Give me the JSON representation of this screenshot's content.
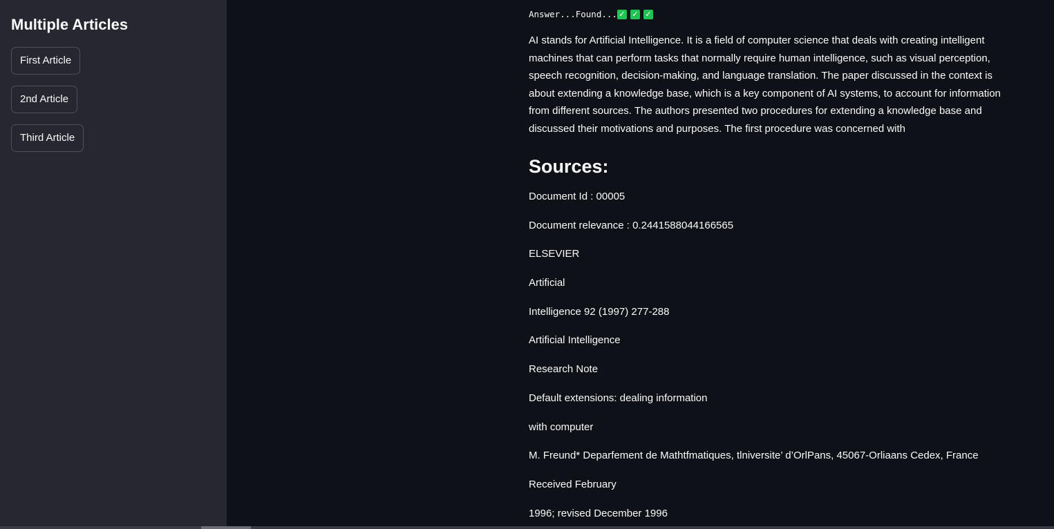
{
  "sidebar": {
    "title": "Multiple Articles",
    "buttons": [
      {
        "label": "First Article"
      },
      {
        "label": "2nd Article"
      },
      {
        "label": "Third Article"
      }
    ]
  },
  "main": {
    "answer_status": "Answer...Found...",
    "check_icon": "✓",
    "answer_text": "AI stands for Artificial Intelligence. It is a field of computer science that deals with creating intelligent machines that can perform tasks that normally require human intelligence, such as visual perception, speech recognition, decision-making, and language translation. The paper discussed in the context is about extending a knowledge base, which is a key component of AI systems, to account for information from different sources. The authors presented two procedures for extending a knowledge base and discussed their motivations and purposes. The first procedure was concerned with",
    "sources_heading": "Sources:",
    "sources": [
      "Document Id : 00005",
      "Document relevance : 0.2441588044166565",
      "ELSEVIER",
      "Artificial",
      "Intelligence 92 (1997) 277-288",
      "Artificial Intelligence",
      "Research Note",
      "Default extensions: dealing information",
      "with computer",
      "M. Freund* Deparfement de Mathtfmatiques, tlniversite’ d’OrlPans, 45067-Orliaans Cedex, France",
      "Received February",
      "1996; revised December 1996"
    ]
  },
  "colors": {
    "background": "#0e1117",
    "sidebar": "#262730",
    "check": "#21c354",
    "text": "#fafafa"
  }
}
